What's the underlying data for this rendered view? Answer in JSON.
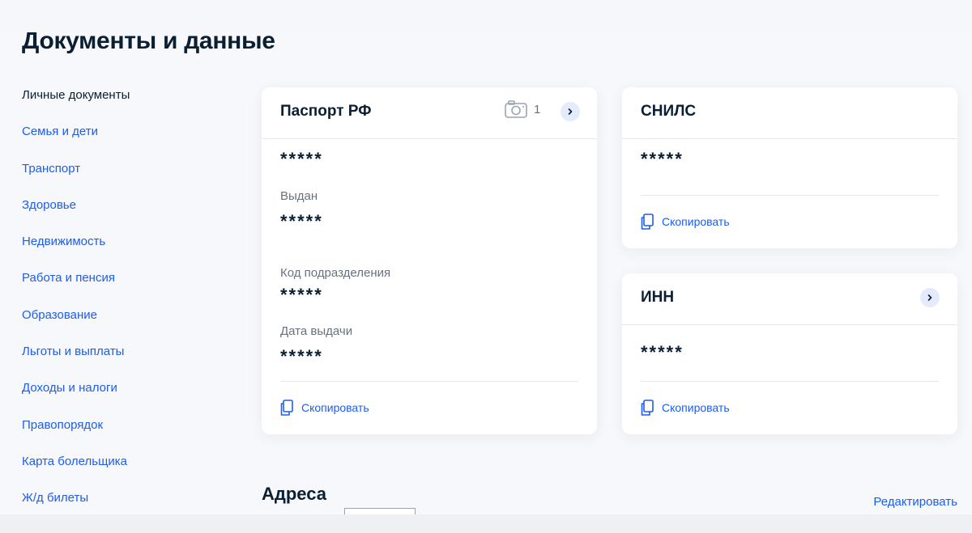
{
  "page": {
    "title": "Документы и данные"
  },
  "sidebar": {
    "items": [
      {
        "label": "Личные документы",
        "active": true
      },
      {
        "label": "Семья и дети"
      },
      {
        "label": "Транспорт"
      },
      {
        "label": "Здоровье"
      },
      {
        "label": "Недвижимость"
      },
      {
        "label": "Работа и пенсия"
      },
      {
        "label": "Образование"
      },
      {
        "label": "Льготы и выплаты"
      },
      {
        "label": "Доходы и налоги"
      },
      {
        "label": "Правопорядок"
      },
      {
        "label": "Карта болельщика"
      },
      {
        "label": "Ж/д билеты"
      }
    ]
  },
  "passport": {
    "title": "Паспорт РФ",
    "photo_count": "1",
    "number": "*****",
    "issued_label": "Выдан",
    "issued_value": "*****",
    "dept_code_label": "Код подразделения",
    "dept_code_value": "*****",
    "issue_date_label": "Дата выдачи",
    "issue_date_value": "*****",
    "copy_label": "Скопировать"
  },
  "snils": {
    "title": "СНИЛС",
    "number": "*****",
    "copy_label": "Скопировать"
  },
  "inn": {
    "title": "ИНН",
    "number": "*****",
    "copy_label": "Скопировать"
  },
  "addresses": {
    "title": "Адреса",
    "edit_label": "Редактировать"
  },
  "icons": {
    "camera": "camera-icon",
    "chevron": "chevron-right-icon",
    "copy": "copy-icon"
  },
  "colors": {
    "accent": "#1d5deb",
    "text": "#0b1f33",
    "muted": "#66727f",
    "chevron_bg": "#e3ebfc",
    "background": "#f7f8fb"
  }
}
